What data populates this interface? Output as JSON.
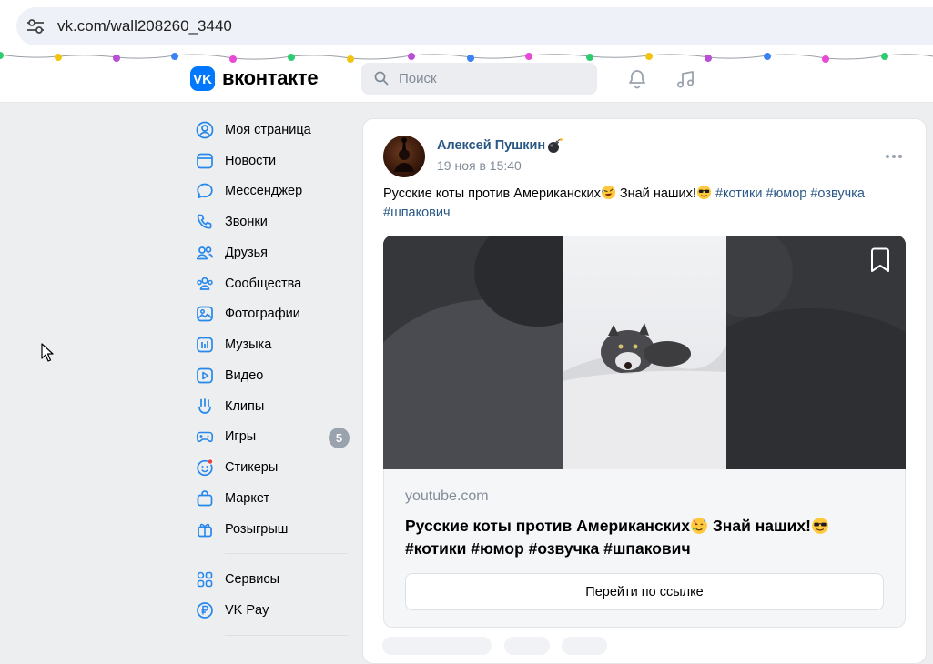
{
  "browser": {
    "url": "vk.com/wall208260_3440",
    "site_info_icon": "tune-icon"
  },
  "header": {
    "logo_text": "вконтакте",
    "search_placeholder": "Поиск",
    "icons": [
      "bell-icon",
      "music-note-icon"
    ],
    "brand_color": "#0077ff"
  },
  "sidebar": {
    "items": [
      {
        "label": "Моя страница",
        "icon": "user-circle-icon"
      },
      {
        "label": "Новости",
        "icon": "news-icon"
      },
      {
        "label": "Мессенджер",
        "icon": "chat-bubble-icon"
      },
      {
        "label": "Звонки",
        "icon": "phone-icon"
      },
      {
        "label": "Друзья",
        "icon": "friends-icon"
      },
      {
        "label": "Сообщества",
        "icon": "communities-icon"
      },
      {
        "label": "Фотографии",
        "icon": "photo-icon"
      },
      {
        "label": "Музыка",
        "icon": "music-icon"
      },
      {
        "label": "Видео",
        "icon": "video-icon"
      },
      {
        "label": "Клипы",
        "icon": "clips-icon"
      },
      {
        "label": "Игры",
        "icon": "gamepad-icon",
        "badge": "5"
      },
      {
        "label": "Стикеры",
        "icon": "sticker-icon"
      },
      {
        "label": "Маркет",
        "icon": "market-bag-icon"
      },
      {
        "label": "Розыгрыш",
        "icon": "gift-icon"
      },
      {
        "label": "Сервисы",
        "icon": "services-grid-icon"
      },
      {
        "label": "VK Pay",
        "icon": "ruble-icon"
      }
    ]
  },
  "post": {
    "author": "Алексей Пушкин",
    "author_emoji": "bomb-icon",
    "date": "19 ноя в 15:40",
    "text_main": "Русские коты против Американских",
    "text_mid": " Знай наших!",
    "hashtags_line1": "#котики #юмор #озвучка",
    "hashtags_line2": "#шпакович",
    "link": {
      "domain": "youtube.com",
      "title_line1": "Русские коты против Американских",
      "title_mid": " Знай наших!",
      "title_line2": "#котики #юмор #озвучка #шпакович",
      "button_label": "Перейти по ссылке"
    }
  }
}
